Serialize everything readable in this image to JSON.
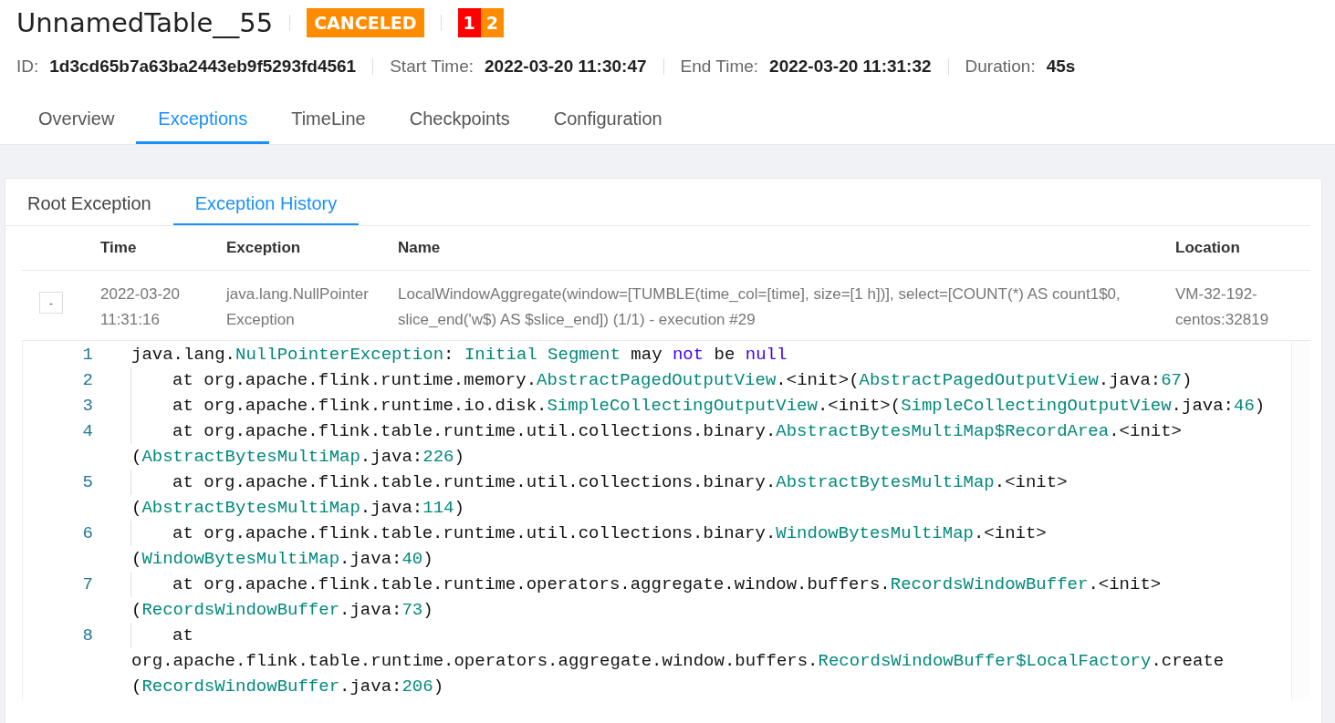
{
  "job": {
    "title": "UnnamedTable__55",
    "status": {
      "label": "CANCELED",
      "color": "#ff8c00"
    },
    "task_counts": [
      {
        "value": "1",
        "color": "#ff0000"
      },
      {
        "value": "2",
        "color": "#ff8c00"
      }
    ]
  },
  "info": [
    {
      "label": "ID:",
      "value": "1d3cd65b7a63ba2443eb9f5293fd4561"
    },
    {
      "label": "Start Time:",
      "value": "2022-03-20 11:30:47"
    },
    {
      "label": "End Time:",
      "value": "2022-03-20 11:31:32"
    },
    {
      "label": "Duration:",
      "value": "45s"
    }
  ],
  "tabs": [
    {
      "label": "Overview",
      "selected": false
    },
    {
      "label": "Exceptions",
      "selected": true
    },
    {
      "label": "TimeLine",
      "selected": false
    },
    {
      "label": "Checkpoints",
      "selected": false
    },
    {
      "label": "Configuration",
      "selected": false
    }
  ],
  "sub_tabs": [
    {
      "label": "Root Exception",
      "selected": false
    },
    {
      "label": "Exception History",
      "selected": true
    }
  ],
  "table": {
    "columns": [
      "Time",
      "Exception",
      "Name",
      "Location"
    ],
    "rows": [
      {
        "toggle": "-",
        "expanded": true,
        "time": [
          "2022-03-20",
          "11:31:16"
        ],
        "exception": [
          "java.lang.NullPointer",
          "Exception"
        ],
        "name": [
          "LocalWindowAggregate(window=[TUMBLE(time_col=[time], size=[1 h])], select=[COUNT(*) AS count1$0,",
          "slice_end('w$) AS $slice_end]) (1/1) - execution #29"
        ],
        "location": [
          "VM-32-192-",
          "centos:32819"
        ],
        "stack": [
          {
            "number": "1",
            "rows": [
              {
                "indented": false,
                "tokens": [
                  {
                    "kind": "plain",
                    "text": "java.lang."
                  },
                  {
                    "kind": "type",
                    "text": "NullPointerException"
                  },
                  {
                    "kind": "plain",
                    "text": ": "
                  },
                  {
                    "kind": "type",
                    "text": "Initial Segment"
                  },
                  {
                    "kind": "plain",
                    "text": " may "
                  },
                  {
                    "kind": "keyword",
                    "text": "not"
                  },
                  {
                    "kind": "plain",
                    "text": " be "
                  },
                  {
                    "kind": "keyword",
                    "text": "null"
                  }
                ]
              }
            ]
          },
          {
            "number": "2",
            "rows": [
              {
                "indented": true,
                "tokens": [
                  {
                    "kind": "plain",
                    "text": "at org.apache.flink.runtime.memory."
                  },
                  {
                    "kind": "type",
                    "text": "AbstractPagedOutputView"
                  },
                  {
                    "kind": "plain",
                    "text": ".<init>("
                  },
                  {
                    "kind": "type",
                    "text": "AbstractPagedOutputView"
                  },
                  {
                    "kind": "plain",
                    "text": ".java:"
                  },
                  {
                    "kind": "number",
                    "text": "67"
                  },
                  {
                    "kind": "plain",
                    "text": ")"
                  }
                ]
              }
            ]
          },
          {
            "number": "3",
            "rows": [
              {
                "indented": true,
                "tokens": [
                  {
                    "kind": "plain",
                    "text": "at org.apache.flink.runtime.io.disk."
                  },
                  {
                    "kind": "type",
                    "text": "SimpleCollectingOutputView"
                  },
                  {
                    "kind": "plain",
                    "text": ".<init>("
                  },
                  {
                    "kind": "type",
                    "text": "SimpleCollectingOutputView"
                  },
                  {
                    "kind": "plain",
                    "text": ".java:"
                  },
                  {
                    "kind": "number",
                    "text": "46"
                  },
                  {
                    "kind": "plain",
                    "text": ")"
                  }
                ]
              }
            ]
          },
          {
            "number": "4",
            "rows": [
              {
                "indented": true,
                "tokens": [
                  {
                    "kind": "plain",
                    "text": "at org.apache.flink.table.runtime.util.collections.binary."
                  },
                  {
                    "kind": "type",
                    "text": "AbstractBytesMultiMap$RecordArea"
                  },
                  {
                    "kind": "plain",
                    "text": ".<init>"
                  }
                ]
              },
              {
                "indented": false,
                "tokens": [
                  {
                    "kind": "plain",
                    "text": "("
                  },
                  {
                    "kind": "type",
                    "text": "AbstractBytesMultiMap"
                  },
                  {
                    "kind": "plain",
                    "text": ".java:"
                  },
                  {
                    "kind": "number",
                    "text": "226"
                  },
                  {
                    "kind": "plain",
                    "text": ")"
                  }
                ]
              }
            ]
          },
          {
            "number": "5",
            "rows": [
              {
                "indented": true,
                "tokens": [
                  {
                    "kind": "plain",
                    "text": "at org.apache.flink.table.runtime.util.collections.binary."
                  },
                  {
                    "kind": "type",
                    "text": "AbstractBytesMultiMap"
                  },
                  {
                    "kind": "plain",
                    "text": ".<init>"
                  }
                ]
              },
              {
                "indented": false,
                "tokens": [
                  {
                    "kind": "plain",
                    "text": "("
                  },
                  {
                    "kind": "type",
                    "text": "AbstractBytesMultiMap"
                  },
                  {
                    "kind": "plain",
                    "text": ".java:"
                  },
                  {
                    "kind": "number",
                    "text": "114"
                  },
                  {
                    "kind": "plain",
                    "text": ")"
                  }
                ]
              }
            ]
          },
          {
            "number": "6",
            "rows": [
              {
                "indented": true,
                "tokens": [
                  {
                    "kind": "plain",
                    "text": "at org.apache.flink.table.runtime.util.collections.binary."
                  },
                  {
                    "kind": "type",
                    "text": "WindowBytesMultiMap"
                  },
                  {
                    "kind": "plain",
                    "text": ".<init>"
                  }
                ]
              },
              {
                "indented": false,
                "tokens": [
                  {
                    "kind": "plain",
                    "text": "("
                  },
                  {
                    "kind": "type",
                    "text": "WindowBytesMultiMap"
                  },
                  {
                    "kind": "plain",
                    "text": ".java:"
                  },
                  {
                    "kind": "number",
                    "text": "40"
                  },
                  {
                    "kind": "plain",
                    "text": ")"
                  }
                ]
              }
            ]
          },
          {
            "number": "7",
            "rows": [
              {
                "indented": true,
                "tokens": [
                  {
                    "kind": "plain",
                    "text": "at org.apache.flink.table.runtime.operators.aggregate.window.buffers."
                  },
                  {
                    "kind": "type",
                    "text": "RecordsWindowBuffer"
                  },
                  {
                    "kind": "plain",
                    "text": ".<init>"
                  }
                ]
              },
              {
                "indented": false,
                "tokens": [
                  {
                    "kind": "plain",
                    "text": "("
                  },
                  {
                    "kind": "type",
                    "text": "RecordsWindowBuffer"
                  },
                  {
                    "kind": "plain",
                    "text": ".java:"
                  },
                  {
                    "kind": "number",
                    "text": "73"
                  },
                  {
                    "kind": "plain",
                    "text": ")"
                  }
                ]
              }
            ]
          },
          {
            "number": "8",
            "rows": [
              {
                "indented": true,
                "tokens": [
                  {
                    "kind": "plain",
                    "text": "at"
                  }
                ]
              },
              {
                "indented": false,
                "tokens": [
                  {
                    "kind": "plain",
                    "text": "org.apache.flink.table.runtime.operators.aggregate.window.buffers."
                  },
                  {
                    "kind": "type",
                    "text": "RecordsWindowBuffer$LocalFactory"
                  },
                  {
                    "kind": "plain",
                    "text": ".create"
                  }
                ]
              },
              {
                "indented": false,
                "tokens": [
                  {
                    "kind": "plain",
                    "text": "("
                  },
                  {
                    "kind": "type",
                    "text": "RecordsWindowBuffer"
                  },
                  {
                    "kind": "plain",
                    "text": ".java:"
                  },
                  {
                    "kind": "number",
                    "text": "206"
                  },
                  {
                    "kind": "plain",
                    "text": ")"
                  }
                ]
              }
            ]
          }
        ]
      }
    ]
  }
}
